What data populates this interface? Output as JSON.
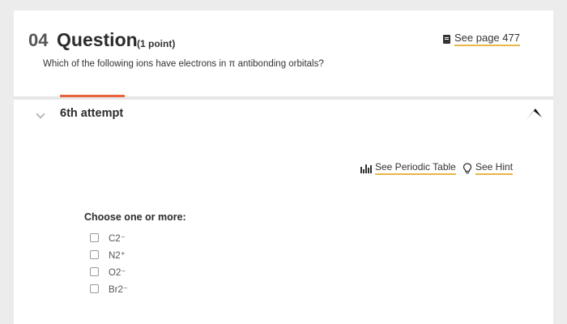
{
  "question": {
    "number": "04",
    "title": "Question",
    "points": "(1 point)",
    "see_page": "See page 477",
    "prompt": "Which of the following ions have electrons in π antibonding orbitals?"
  },
  "attempt": {
    "label": "6th attempt"
  },
  "tools": {
    "periodic_table": "See Periodic Table",
    "hint": "See Hint"
  },
  "answer": {
    "instruction": "Choose one or more:",
    "options": [
      "C2⁻",
      "N2⁺",
      "O2⁻",
      "Br2⁻"
    ]
  },
  "colors": {
    "accent_orange": "#e8623c",
    "link_underline": "#e8b64a"
  },
  "icons": [
    "book-icon",
    "chevron-down-icon",
    "flag-icon",
    "periodic-table-icon",
    "lightbulb-icon"
  ]
}
